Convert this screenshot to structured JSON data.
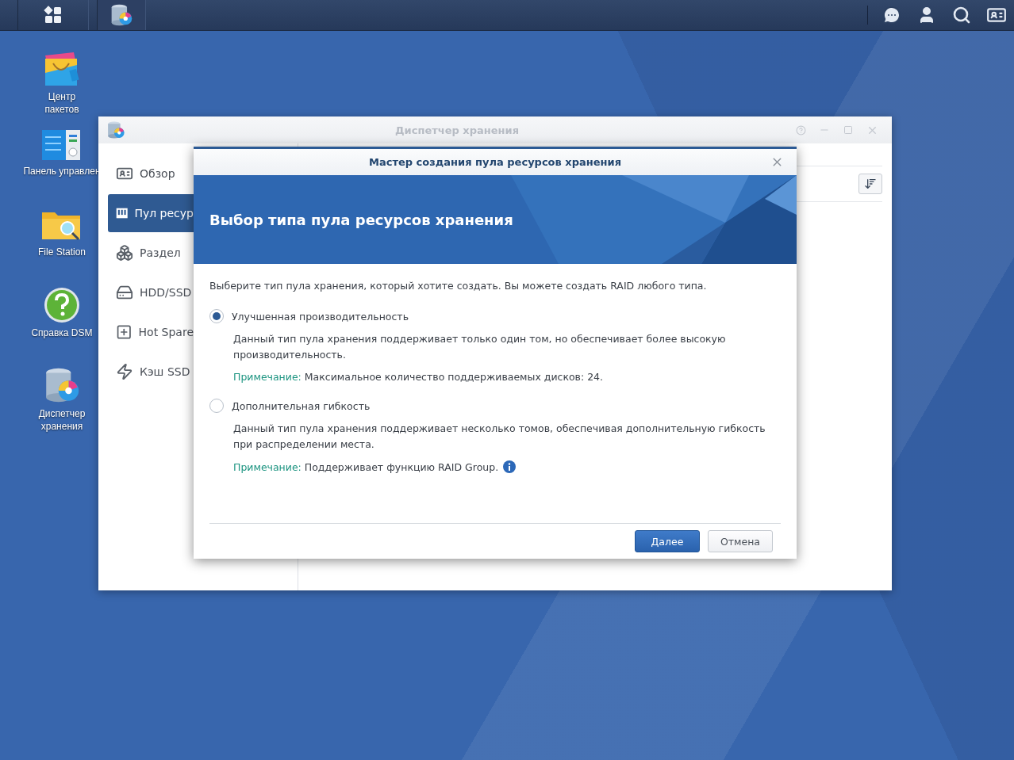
{
  "desktop_icons": [
    {
      "label": "Центр пакетов",
      "kind": "package"
    },
    {
      "label": "Панель управлен",
      "kind": "control"
    },
    {
      "label": "File Station",
      "kind": "folder"
    },
    {
      "label": "Справка DSM",
      "kind": "help"
    },
    {
      "label": "Диспетчер хранения",
      "kind": "storage"
    }
  ],
  "window": {
    "title": "Диспетчер хранения",
    "sidebar": [
      {
        "label": "Обзор",
        "kind": "overview",
        "selected": false
      },
      {
        "label": "Пул ресур",
        "kind": "pool",
        "selected": true
      },
      {
        "label": "Раздел",
        "kind": "volume",
        "selected": false
      },
      {
        "label": "HDD/SSD",
        "kind": "disk",
        "selected": false
      },
      {
        "label": "Hot Spare",
        "kind": "spare",
        "selected": false
      },
      {
        "label": "Кэш SSD",
        "kind": "cache",
        "selected": false
      }
    ]
  },
  "dialog": {
    "title": "Мастер создания пула ресурсов хранения",
    "heading": "Выбор типа пула ресурсов хранения",
    "intro": "Выберите тип пула хранения, который хотите создать. Вы можете создать RAID любого типа.",
    "options": [
      {
        "label": "Улучшенная производительность",
        "selected": true,
        "description": "Данный тип пула хранения поддерживает только один том, но обеспечивает более высокую производительность.",
        "note_label": "Примечание:",
        "note_text": "Максимальное количество поддерживаемых дисков: 24.",
        "info": false
      },
      {
        "label": "Дополнительная гибкость",
        "selected": false,
        "description": "Данный тип пула хранения поддерживает несколько томов, обеспечивая дополнительную гибкость при распределении места.",
        "note_label": "Примечание:",
        "note_text": "Поддерживает функцию RAID Group.",
        "info": true
      }
    ],
    "buttons": [
      {
        "label": "Далее",
        "kind": "primary"
      },
      {
        "label": "Отмена",
        "kind": "secondary"
      }
    ]
  }
}
